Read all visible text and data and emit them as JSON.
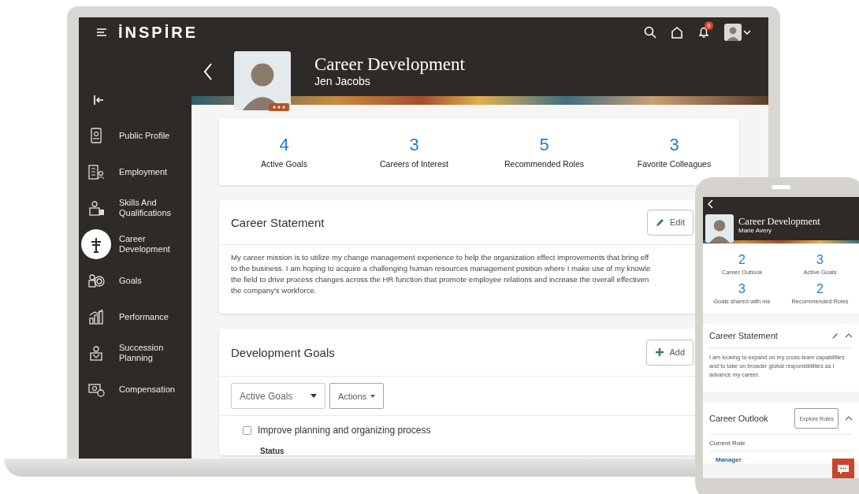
{
  "laptop": {
    "app_bar": {
      "logo": "İNSPİRE",
      "notification_count": "9"
    },
    "sidebar": {
      "items": [
        {
          "label": "Public Profile",
          "selected": false
        },
        {
          "label": "Employment",
          "selected": false
        },
        {
          "label": "Skills And Qualifications",
          "selected": false
        },
        {
          "label": "Career Development",
          "selected": true
        },
        {
          "label": "Goals",
          "selected": false
        },
        {
          "label": "Performance",
          "selected": false
        },
        {
          "label": "Succession Planning",
          "selected": false
        },
        {
          "label": "Compensation",
          "selected": false
        }
      ]
    },
    "header": {
      "title": "Career Development",
      "subtitle": "Jen Jacobs"
    },
    "stats": [
      {
        "value": "4",
        "label": "Active Goals"
      },
      {
        "value": "3",
        "label": "Careers of Interest"
      },
      {
        "value": "5",
        "label": "Recommended Roles"
      },
      {
        "value": "3",
        "label": "Favorite Colleagues"
      }
    ],
    "career_statement": {
      "title": "Career Statement",
      "edit_label": "Edit",
      "lines": [
        "My career mission is to utilize my change management experience to help the organization effect improvements that bring eff",
        "to the business. I am hoping to acquire a challenging human resources management position where I make use of my knowle",
        "the field to drive process changes across the HR function that promote employee relations and increase the overall effectiven",
        "the company's workforce."
      ]
    },
    "development_goals": {
      "title": "Development Goals",
      "add_label": "Add",
      "filter_value": "Active Goals",
      "actions_label": "Actions",
      "goals": [
        {
          "label": "Improve planning and organizing process",
          "checked": false
        }
      ],
      "status_label": "Status"
    }
  },
  "phone": {
    "header": {
      "title": "Career Development",
      "subtitle": "Marie Avery"
    },
    "stats": [
      {
        "value": "2",
        "label": "Career Outlook"
      },
      {
        "value": "3",
        "label": "Active Goals"
      },
      {
        "value": "3",
        "label": "Goals shared with me"
      },
      {
        "value": "2",
        "label": "Recommended Roles"
      }
    ],
    "career_statement": {
      "title": "Career Statement",
      "text": "I am looking to expand on my cross-team capabilities and to take on broader global responsibilities as I advance my career."
    },
    "career_outlook": {
      "title": "Career Outlook",
      "button_label": "Explore Roles",
      "current_role_label": "Current Role",
      "current_role": "Manager"
    }
  }
}
